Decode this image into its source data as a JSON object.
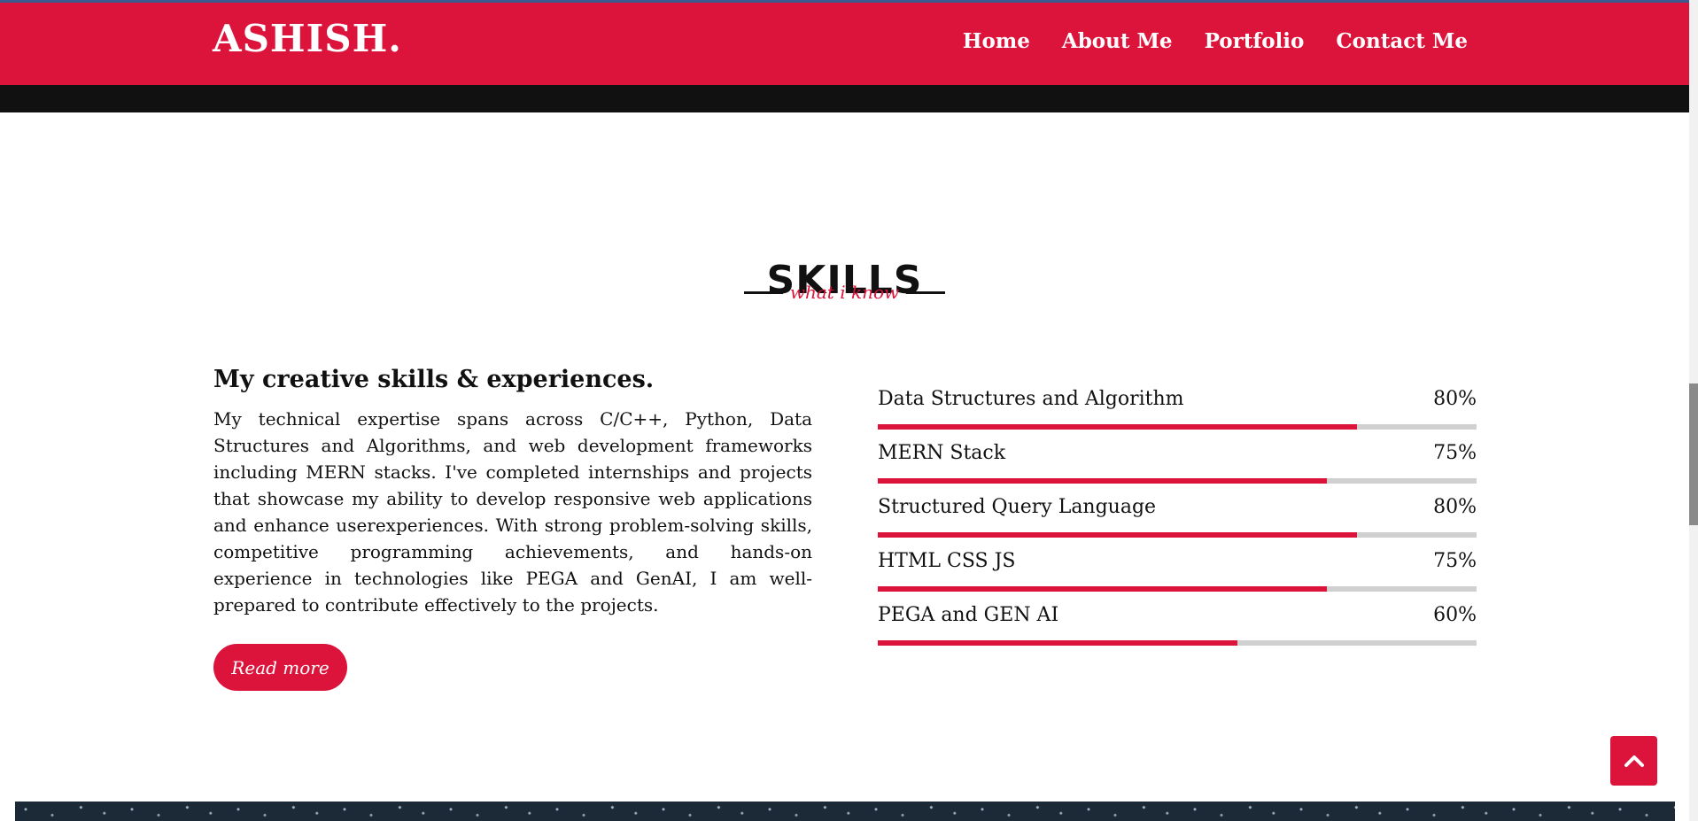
{
  "header": {
    "logo": "ASHISH.",
    "nav": [
      "Home",
      "About Me",
      "Portfolio",
      "Contact Me"
    ]
  },
  "skills_section": {
    "title": "SKILLS",
    "subtitle": "what i know",
    "heading": "My creative skills & experiences.",
    "paragraph": "My technical expertise spans across C/C++, Python, Data Structures and Algorithms, and web development frameworks including MERN stacks. I've completed internships and projects that showcase my ability to develop responsive web applications and enhance userexperiences. With strong problem-solving skills, competitive programming achievements, and hands-on experience in technologies like PEGA and GenAI, I am well-prepared to contribute effectively to the projects.",
    "read_more_label": "Read more",
    "skills": [
      {
        "name": "Data Structures and Algorithm",
        "percent_label": "80%",
        "level": 0.8
      },
      {
        "name": "MERN Stack",
        "percent_label": "75%",
        "level": 0.75
      },
      {
        "name": "Structured Query Language",
        "percent_label": "80%",
        "level": 0.8
      },
      {
        "name": "HTML CSS JS",
        "percent_label": "75%",
        "level": 0.75
      },
      {
        "name": "PEGA and GEN AI",
        "percent_label": "60%",
        "level": 0.6
      }
    ]
  },
  "icons": {
    "back_to_top": "chevron-up-icon"
  },
  "colors": {
    "accent": "#dc143c",
    "dark_bar": "#111111",
    "track": "#d0d0d0"
  }
}
